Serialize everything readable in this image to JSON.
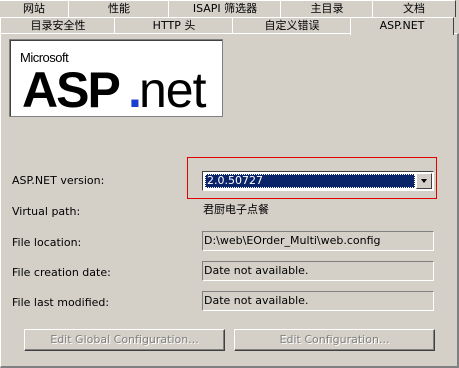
{
  "tabs_back": [
    "网站",
    "性能",
    "ISAPI 筛选器",
    "主目录",
    "文档"
  ],
  "tabs_front": [
    "目录安全性",
    "HTTP 头",
    "自定义错误",
    "ASP.NET"
  ],
  "logo": {
    "microsoft": "Microsoft",
    "asp": "ASP",
    "dot": ".",
    "net": "net"
  },
  "fields": {
    "version_label": "ASP.NET version:",
    "version_value": "2.0.50727",
    "virtual_path_label": "Virtual path:",
    "virtual_path_value": "君厨电子点餐",
    "file_location_label": "File location:",
    "file_location_value": "D:\\web\\EOrder_Multi\\web.config",
    "creation_date_label": "File creation date:",
    "creation_date_value": "Date not available.",
    "last_modified_label": "File last modified:",
    "last_modified_value": "Date not available."
  },
  "buttons": {
    "edit_global": "Edit Global Configuration...",
    "edit_config": "Edit Configuration..."
  },
  "colors": {
    "selection": "#0a246a",
    "highlight_box": "#e00000",
    "dot": "#1a3fd0"
  }
}
